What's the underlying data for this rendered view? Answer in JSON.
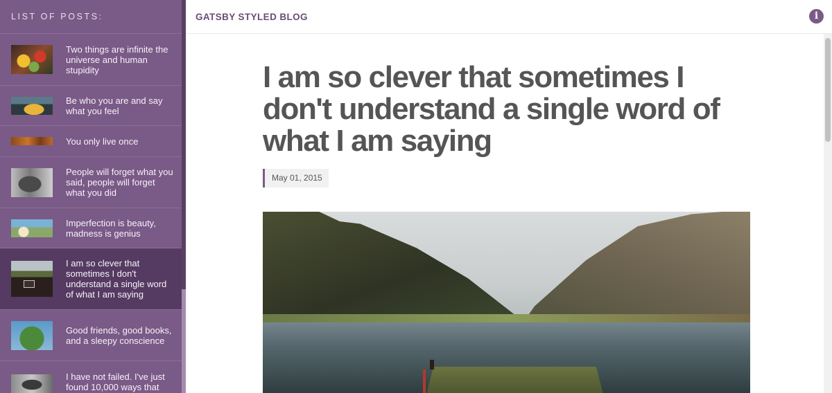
{
  "sidebar": {
    "header": "List of posts:",
    "posts": [
      {
        "title": "Two things are infinite the universe and human stupidity",
        "active": false
      },
      {
        "title": "Be who you are and say what you feel",
        "active": false
      },
      {
        "title": "You only live once",
        "active": false
      },
      {
        "title": "People will forget what you said, people will forget what you did",
        "active": false
      },
      {
        "title": "Imperfection is beauty, madness is genius",
        "active": false
      },
      {
        "title": "I am so clever that sometimes I don't understand a single word of what I am saying",
        "active": true
      },
      {
        "title": "Good friends, good books, and a sleepy conscience",
        "active": false
      },
      {
        "title": "I have not failed. I've just found 10,000 ways that",
        "active": false
      }
    ]
  },
  "topbar": {
    "blog_title": "Gatsby Styled Blog",
    "info_icon": "info-icon"
  },
  "article": {
    "title": "I am so clever that sometimes I don't understand a single word of what I am saying",
    "date": "May 01, 2015"
  },
  "colors": {
    "sidebar_bg": "#7a5a86",
    "active_item_bg": "#553b61",
    "accent": "#6a4d75",
    "title_text": "#555555"
  }
}
